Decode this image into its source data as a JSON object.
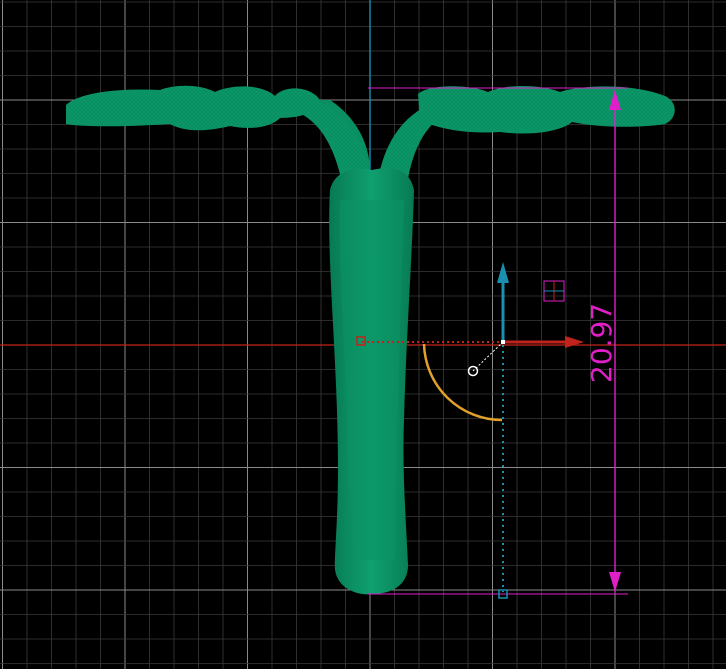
{
  "viewport": {
    "background": "#000000",
    "grid_minor_color": "#3a3a3a",
    "grid_major_color": "#8a8a8a",
    "x_axis_color": "#c0231b",
    "y_axis_color": "#1b8fb0",
    "model_color": "#0a8f62",
    "model_shade": "#0b7a55"
  },
  "dimension": {
    "value": "20.97",
    "color": "#e01fc8"
  },
  "gizmo": {
    "x_arrow_color": "#c0231b",
    "y_arrow_color": "#1b8fb0",
    "rotate_arc_color": "#e0a02a",
    "pivot_color": "#ffffff",
    "origin_marker_color": "#c0231b",
    "base_marker_color": "#1b8fb0",
    "plane_handle_icon": "plane-handle-icon"
  }
}
